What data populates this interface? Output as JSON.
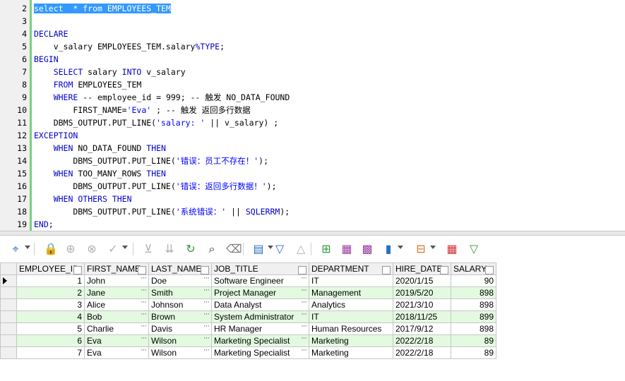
{
  "editor": {
    "lines": [
      {
        "n": "2",
        "segs": [
          {
            "t": "select  * from EMPLOYEES_TEM",
            "c": "sel"
          }
        ]
      },
      {
        "n": "3",
        "segs": []
      },
      {
        "n": "4",
        "segs": [
          {
            "t": "DECLARE",
            "c": "kw"
          }
        ]
      },
      {
        "n": "5",
        "segs": [
          {
            "t": "    v_salary EMPLOYEES_TEM.salary",
            "c": ""
          },
          {
            "t": "%TYPE",
            "c": "kw"
          },
          {
            "t": ";",
            "c": ""
          }
        ]
      },
      {
        "n": "6",
        "segs": [
          {
            "t": "BEGIN",
            "c": "kw"
          }
        ]
      },
      {
        "n": "7",
        "segs": [
          {
            "t": "    ",
            "c": ""
          },
          {
            "t": "SELECT",
            "c": "kw"
          },
          {
            "t": " salary ",
            "c": ""
          },
          {
            "t": "INTO",
            "c": "kw"
          },
          {
            "t": " v_salary",
            "c": ""
          }
        ]
      },
      {
        "n": "8",
        "segs": [
          {
            "t": "    ",
            "c": ""
          },
          {
            "t": "FROM",
            "c": "kw"
          },
          {
            "t": " EMPLOYEES_TEM",
            "c": ""
          }
        ]
      },
      {
        "n": "9",
        "segs": [
          {
            "t": "    ",
            "c": ""
          },
          {
            "t": "WHERE",
            "c": "kw"
          },
          {
            "t": " -- employee_id = 999; -- 触发 NO_DATA_FOUND",
            "c": ""
          }
        ]
      },
      {
        "n": "10",
        "segs": [
          {
            "t": "        FIRST_NAME=",
            "c": ""
          },
          {
            "t": "'Eva'",
            "c": "str"
          },
          {
            "t": " ; -- 触发 返回多行数据",
            "c": ""
          }
        ]
      },
      {
        "n": "11",
        "segs": [
          {
            "t": "    DBMS_OUTPUT.PUT_LINE(",
            "c": ""
          },
          {
            "t": "'salary: '",
            "c": "str"
          },
          {
            "t": " || v_salary) ;",
            "c": ""
          }
        ]
      },
      {
        "n": "12",
        "segs": [
          {
            "t": "EXCEPTION",
            "c": "kw"
          }
        ]
      },
      {
        "n": "13",
        "segs": [
          {
            "t": "    ",
            "c": ""
          },
          {
            "t": "WHEN",
            "c": "kw"
          },
          {
            "t": " NO_DATA_FOUND ",
            "c": ""
          },
          {
            "t": "THEN",
            "c": "kw"
          }
        ]
      },
      {
        "n": "14",
        "segs": [
          {
            "t": "        DBMS_OUTPUT.PUT_LINE(",
            "c": ""
          },
          {
            "t": "'错误：员工不存在！'",
            "c": "str"
          },
          {
            "t": ");",
            "c": ""
          }
        ]
      },
      {
        "n": "15",
        "segs": [
          {
            "t": "    ",
            "c": ""
          },
          {
            "t": "WHEN",
            "c": "kw"
          },
          {
            "t": " TOO_MANY_ROWS ",
            "c": ""
          },
          {
            "t": "THEN",
            "c": "kw"
          }
        ]
      },
      {
        "n": "16",
        "segs": [
          {
            "t": "        DBMS_OUTPUT.PUT_LINE(",
            "c": ""
          },
          {
            "t": "'错误：返回多行数据！'",
            "c": "str"
          },
          {
            "t": ");",
            "c": ""
          }
        ]
      },
      {
        "n": "17",
        "segs": [
          {
            "t": "    ",
            "c": ""
          },
          {
            "t": "WHEN",
            "c": "kw"
          },
          {
            "t": " ",
            "c": ""
          },
          {
            "t": "OTHERS",
            "c": "kw"
          },
          {
            "t": " ",
            "c": ""
          },
          {
            "t": "THEN",
            "c": "kw"
          }
        ]
      },
      {
        "n": "18",
        "segs": [
          {
            "t": "        DBMS_OUTPUT.PUT_LINE(",
            "c": ""
          },
          {
            "t": "'系统错误：'",
            "c": "str"
          },
          {
            "t": " || ",
            "c": ""
          },
          {
            "t": "SQLERRM",
            "c": "kw"
          },
          {
            "t": ");",
            "c": ""
          }
        ]
      },
      {
        "n": "19",
        "segs": [
          {
            "t": "END",
            "c": "kw"
          },
          {
            "t": ";",
            "c": ""
          }
        ]
      }
    ]
  },
  "toolbar": {
    "icons": [
      {
        "name": "grid-options-icon",
        "glyph": "⌖",
        "color": "#2a6fc0",
        "dd": true
      },
      {
        "name": "lock-icon",
        "glyph": "🔒",
        "color": "#d03030"
      },
      {
        "name": "add-row-icon",
        "glyph": "⊕",
        "color": "#b0b0b0"
      },
      {
        "name": "delete-row-icon",
        "glyph": "⊗",
        "color": "#b0b0b0"
      },
      {
        "name": "apply-icon",
        "glyph": "✓",
        "color": "#b0b0b0",
        "dd": true
      },
      {
        "name": "move-down-icon",
        "glyph": "⊻",
        "color": "#b0b0b0"
      },
      {
        "name": "fetch-all-icon",
        "glyph": "⇊",
        "color": "#b0b0b0"
      },
      {
        "name": "refresh-icon",
        "glyph": "↻",
        "color": "#2e9c3c"
      },
      {
        "name": "find-icon",
        "glyph": "⌕",
        "color": "#333333"
      },
      {
        "name": "clear-icon",
        "glyph": "⌫",
        "color": "#777777"
      },
      {
        "name": "columns-icon",
        "glyph": "▤",
        "color": "#2a6fc0",
        "dd": true
      },
      {
        "name": "sort-desc-icon",
        "glyph": "▽",
        "color": "#2a6fc0"
      },
      {
        "name": "sort-asc-icon",
        "glyph": "△",
        "color": "#b0b0b0"
      },
      {
        "name": "tree-icon",
        "glyph": "⊞",
        "color": "#2e9c3c"
      },
      {
        "name": "record-view-icon",
        "glyph": "▦",
        "color": "#9a3fa0"
      },
      {
        "name": "export-icon",
        "glyph": "▩",
        "color": "#9a3fa0"
      },
      {
        "name": "chart-icon",
        "glyph": "▮",
        "color": "#2a6fc0",
        "dd": true
      },
      {
        "name": "pivot-icon",
        "glyph": "⊟",
        "color": "#e07020",
        "dd": true
      },
      {
        "name": "table-view-icon",
        "glyph": "▦",
        "color": "#d03030"
      },
      {
        "name": "filter-icon",
        "glyph": "▽",
        "color": "#2e9c3c"
      }
    ]
  },
  "grid": {
    "columns": [
      "EMPLOYEE_ID",
      "FIRST_NAME",
      "LAST_NAME",
      "JOB_TITLE",
      "DEPARTMENT",
      "HIRE_DATE",
      "SALARY"
    ],
    "rows": [
      {
        "cells": [
          "1",
          "John",
          "Doe",
          "Software Engineer",
          "IT",
          "2020/1/15",
          "90"
        ]
      },
      {
        "cells": [
          "2",
          "Jane",
          "Smith",
          "Project Manager",
          "Management",
          "2019/5/20",
          "898"
        ]
      },
      {
        "cells": [
          "3",
          "Alice",
          "Johnson",
          "Data Analyst",
          "Analytics",
          "2021/3/10",
          "898"
        ]
      },
      {
        "cells": [
          "4",
          "Bob",
          "Brown",
          "System Administrator",
          "IT",
          "2018/11/25",
          "899"
        ]
      },
      {
        "cells": [
          "5",
          "Charlie",
          "Davis",
          "HR Manager",
          "Human Resources",
          "2017/9/12",
          "898"
        ]
      },
      {
        "cells": [
          "6",
          "Eva",
          "Wilson",
          "Marketing Specialist",
          "Marketing",
          "2022/2/18",
          "89"
        ]
      },
      {
        "cells": [
          "7",
          "Eva",
          "Wilson",
          "Marketing Specialist",
          "Marketing",
          "2022/2/18",
          "89"
        ]
      }
    ],
    "ellipsis": "···"
  }
}
